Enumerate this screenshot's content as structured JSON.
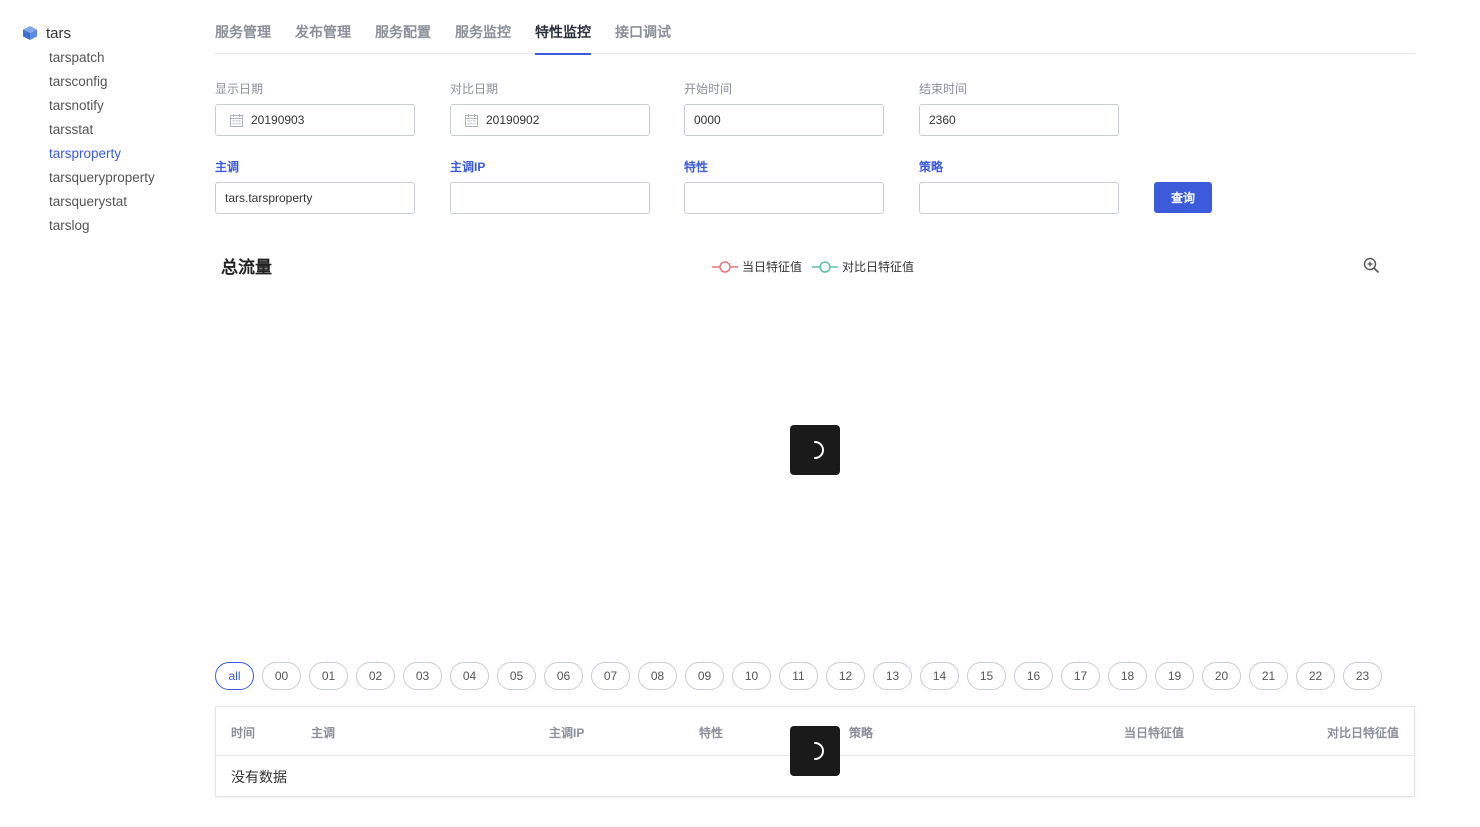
{
  "sidebar": {
    "root": {
      "label": "tars",
      "icon": "cube-icon"
    },
    "items": [
      {
        "label": "tarspatch",
        "active": false
      },
      {
        "label": "tarsconfig",
        "active": false
      },
      {
        "label": "tarsnotify",
        "active": false
      },
      {
        "label": "tarsstat",
        "active": false
      },
      {
        "label": "tarsproperty",
        "active": true
      },
      {
        "label": "tarsqueryproperty",
        "active": false
      },
      {
        "label": "tarsquerystat",
        "active": false
      },
      {
        "label": "tarslog",
        "active": false
      }
    ]
  },
  "tabs": [
    {
      "label": "服务管理",
      "active": false
    },
    {
      "label": "发布管理",
      "active": false
    },
    {
      "label": "服务配置",
      "active": false
    },
    {
      "label": "服务监控",
      "active": false
    },
    {
      "label": "特性监控",
      "active": true
    },
    {
      "label": "接口调试",
      "active": false
    }
  ],
  "form": {
    "show_date": {
      "label": "显示日期",
      "value": "20190903"
    },
    "compare_date": {
      "label": "对比日期",
      "value": "20190902"
    },
    "start_time": {
      "label": "开始时间",
      "value": "0000"
    },
    "end_time": {
      "label": "结束时间",
      "value": "2360"
    },
    "master": {
      "label": "主调",
      "value": "tars.tarsproperty"
    },
    "master_ip": {
      "label": "主调IP",
      "value": ""
    },
    "property": {
      "label": "特性",
      "value": ""
    },
    "policy": {
      "label": "策略",
      "value": ""
    },
    "query_label": "查询"
  },
  "chart": {
    "title": "总流量",
    "legend": [
      {
        "label": "当日特征值",
        "color": "#e8767a"
      },
      {
        "label": "对比日特征值",
        "color": "#5cc0a8"
      }
    ],
    "zoom_icon": "zoom-in-icon"
  },
  "hours": {
    "selected": "all",
    "options": [
      "all",
      "00",
      "01",
      "02",
      "03",
      "04",
      "05",
      "06",
      "07",
      "08",
      "09",
      "10",
      "11",
      "12",
      "13",
      "14",
      "15",
      "16",
      "17",
      "18",
      "19",
      "20",
      "21",
      "22",
      "23"
    ]
  },
  "table": {
    "columns": [
      "时间",
      "主调",
      "主调IP",
      "特性",
      "策略",
      "当日特征值",
      "对比日特征值"
    ],
    "empty_text": "没有数据"
  },
  "colors": {
    "accent": "#3b5bdb",
    "spinner_bg": "#1a1a1a"
  }
}
